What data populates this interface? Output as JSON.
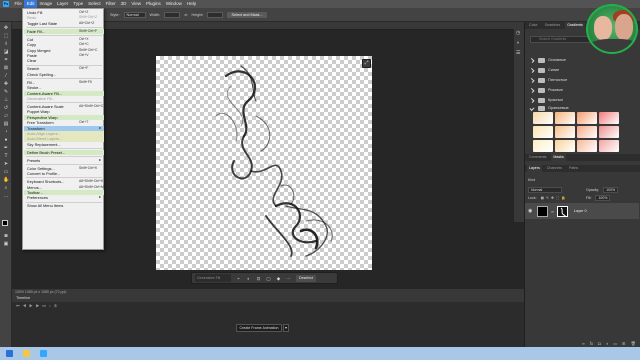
{
  "menubar": {
    "logo": "Ps",
    "items": [
      "File",
      "Edit",
      "Image",
      "Layer",
      "Type",
      "Select",
      "Filter",
      "3D",
      "View",
      "Plugins",
      "Window",
      "Help"
    ],
    "active_index": 1
  },
  "options_bar": {
    "style_label": "Style:",
    "style_value": "Normal",
    "width_label": "Width:",
    "height_label": "Height:",
    "select_mask_label": "Select and Mask..."
  },
  "edit_menu": {
    "items": [
      {
        "label": "Undo Fill",
        "shortcut": "Ctrl+Z",
        "state": ""
      },
      {
        "label": "Redo",
        "shortcut": "Shift+Ctrl+Z",
        "state": "dis"
      },
      {
        "label": "Toggle Last State",
        "shortcut": "Alt+Ctrl+Z",
        "state": ""
      },
      {
        "sep": true
      },
      {
        "label": "Fade Fill...",
        "shortcut": "Shift+Ctrl+F",
        "state": "hl"
      },
      {
        "sep": true
      },
      {
        "label": "Cut",
        "shortcut": "Ctrl+X",
        "state": ""
      },
      {
        "label": "Copy",
        "shortcut": "Ctrl+C",
        "state": ""
      },
      {
        "label": "Copy Merged",
        "shortcut": "Shift+Ctrl+C",
        "state": ""
      },
      {
        "label": "Paste",
        "shortcut": "Ctrl+V",
        "state": ""
      },
      {
        "label": "Clear",
        "shortcut": "",
        "state": ""
      },
      {
        "sep": true
      },
      {
        "label": "Search",
        "shortcut": "Ctrl+F",
        "state": ""
      },
      {
        "label": "Check Spelling...",
        "shortcut": "",
        "state": ""
      },
      {
        "sep": true
      },
      {
        "label": "Fill...",
        "shortcut": "Shift+F5",
        "state": ""
      },
      {
        "label": "Stroke...",
        "shortcut": "",
        "state": ""
      },
      {
        "label": "Content-Aware Fill...",
        "shortcut": "",
        "state": "hl"
      },
      {
        "label": "Generative Fill...",
        "shortcut": "",
        "state": "dis"
      },
      {
        "sep": true
      },
      {
        "label": "Content-Aware Scale",
        "shortcut": "Alt+Shift+Ctrl+C",
        "state": ""
      },
      {
        "label": "Puppet Warp",
        "shortcut": "",
        "state": ""
      },
      {
        "label": "Perspective Warp",
        "shortcut": "",
        "state": "hl"
      },
      {
        "label": "Free Transform",
        "shortcut": "Ctrl+T",
        "state": ""
      },
      {
        "label": "Transform",
        "shortcut": "",
        "state": "sel",
        "submenu": true
      },
      {
        "label": "Auto-Align Layers...",
        "shortcut": "",
        "state": "hl2 dis"
      },
      {
        "label": "Auto-Blend Layers...",
        "shortcut": "",
        "state": "hl2 dis"
      },
      {
        "label": "Sky Replacement...",
        "shortcut": "",
        "state": ""
      },
      {
        "sep": true
      },
      {
        "label": "Define Brush Preset...",
        "shortcut": "",
        "state": "hl"
      },
      {
        "sep": true
      },
      {
        "label": "Presets",
        "shortcut": "",
        "state": "",
        "submenu": true
      },
      {
        "sep": true
      },
      {
        "label": "Color Settings...",
        "shortcut": "Shift+Ctrl+K",
        "state": ""
      },
      {
        "label": "Convert to Profile...",
        "shortcut": "",
        "state": ""
      },
      {
        "sep": true
      },
      {
        "label": "Keyboard Shortcuts...",
        "shortcut": "Alt+Shift+Ctrl+K",
        "state": ""
      },
      {
        "label": "Menus...",
        "shortcut": "Alt+Shift+Ctrl+M",
        "state": ""
      },
      {
        "label": "Toolbar...",
        "shortcut": "",
        "state": "hl"
      },
      {
        "label": "Preferences",
        "shortcut": "",
        "state": "",
        "submenu": true
      },
      {
        "sep": true
      },
      {
        "label": "Show All Menu Items",
        "shortcut": "",
        "state": ""
      }
    ]
  },
  "contextual_bar": {
    "generate_placeholder": "Generative Fill",
    "deselect_label": "Deselect"
  },
  "statusbar": {
    "text": "100% 1080 px x 1080 px (72 ppi)"
  },
  "timeline": {
    "title": "Timeline",
    "create_button": "Create Frame Animation"
  },
  "right_panel": {
    "top_tabs": [
      "Color",
      "Swatches",
      "Gradients",
      "Patterns"
    ],
    "top_active": 2,
    "search_placeholder": "Search Gradients",
    "folders": [
      "Основные",
      "Синие",
      "Пятнистые",
      "Розовые",
      "Красные",
      "Оранжевые"
    ],
    "mid_tabs": [
      "Comments",
      "Masks"
    ],
    "mid_active": 1,
    "layers_tabs": [
      "Layers",
      "Channels",
      "Paths"
    ],
    "layers_active": 0,
    "kind_label": "Kind",
    "blend_mode": "Normal",
    "opacity_label": "Opacity:",
    "opacity_value": "100%",
    "lock_label": "Lock:",
    "fill_label": "Fill:",
    "fill_value": "100%",
    "layer_name": "Layer 0"
  },
  "colors": {
    "accent": "#3a78d6",
    "gradients": [
      "#f4d7a8",
      "#f7b37a",
      "#f49a6c",
      "#f07a7a",
      "#fbe4b0",
      "#f8c08b",
      "#f6a98a",
      "#ef8f8f",
      "#fcefc6",
      "#f9d39b",
      "#f7b79a",
      "#f3a3a3"
    ]
  }
}
